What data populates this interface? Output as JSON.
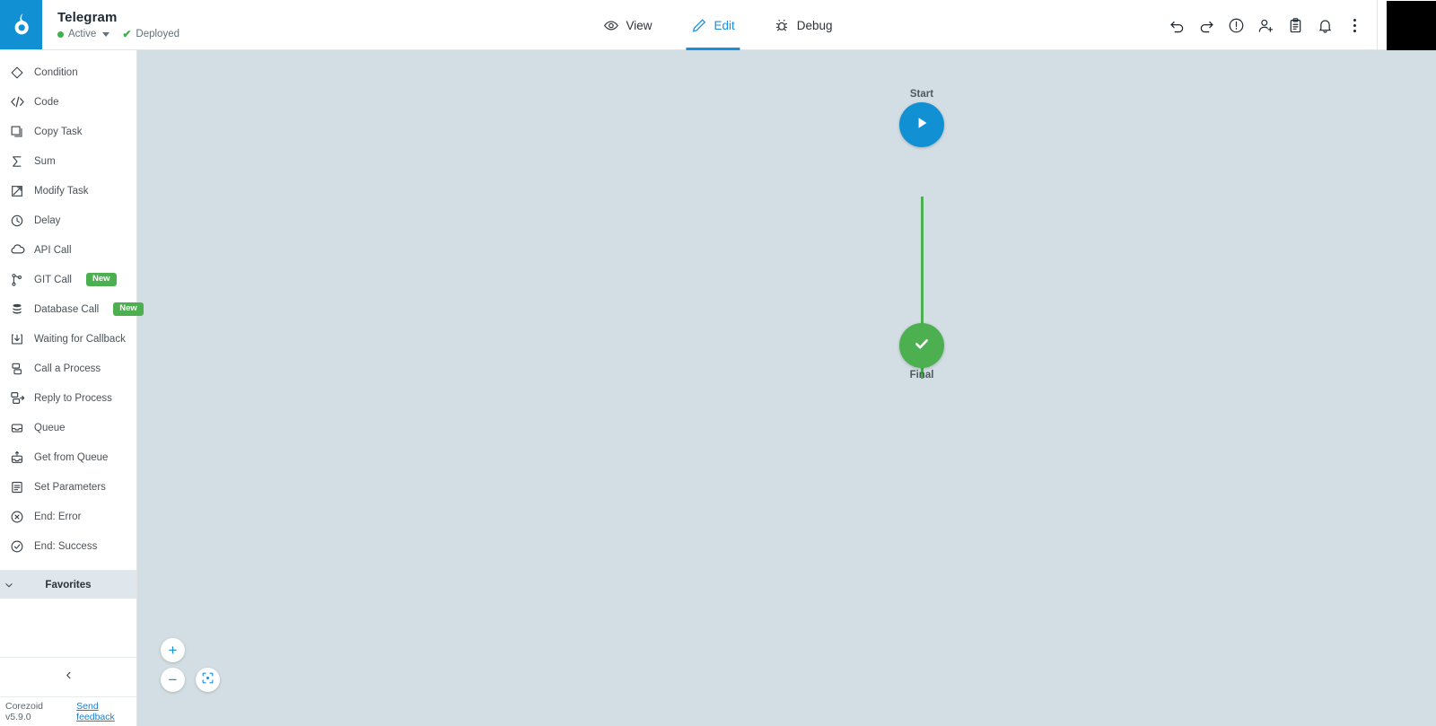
{
  "header": {
    "logo_icon": "corezoid-logo-icon",
    "title": "Telegram",
    "status_label": "Active",
    "deploy_label": "Deployed",
    "deploy_check": "✔",
    "tabs": [
      {
        "label": "View",
        "icon": "eye-icon",
        "active": false
      },
      {
        "label": "Edit",
        "icon": "pencil-icon",
        "active": true
      },
      {
        "label": "Debug",
        "icon": "bug-icon",
        "active": false
      }
    ],
    "actions": [
      {
        "name": "undo-icon"
      },
      {
        "name": "redo-icon"
      },
      {
        "name": "alert-circle-icon"
      },
      {
        "name": "add-user-icon"
      },
      {
        "name": "clipboard-icon"
      },
      {
        "name": "bell-icon"
      },
      {
        "name": "more-vertical-icon"
      }
    ],
    "avatar": "user-avatar"
  },
  "sidebar": {
    "items": [
      {
        "label": "Condition",
        "icon": "diamond-icon",
        "badge": ""
      },
      {
        "label": "Code",
        "icon": "code-icon",
        "badge": ""
      },
      {
        "label": "Copy Task",
        "icon": "copy-task-icon",
        "badge": ""
      },
      {
        "label": "Sum",
        "icon": "sigma-icon",
        "badge": ""
      },
      {
        "label": "Modify Task",
        "icon": "modify-task-icon",
        "badge": ""
      },
      {
        "label": "Delay",
        "icon": "clock-icon",
        "badge": ""
      },
      {
        "label": "API Call",
        "icon": "cloud-icon",
        "badge": ""
      },
      {
        "label": "GIT Call",
        "icon": "git-branch-icon",
        "badge": "New"
      },
      {
        "label": "Database Call",
        "icon": "database-icon",
        "badge": "New"
      },
      {
        "label": "Waiting for Callback",
        "icon": "download-box-icon",
        "badge": ""
      },
      {
        "label": "Call a Process",
        "icon": "call-process-icon",
        "badge": ""
      },
      {
        "label": "Reply to Process",
        "icon": "reply-process-icon",
        "badge": ""
      },
      {
        "label": "Queue",
        "icon": "queue-icon",
        "badge": ""
      },
      {
        "label": "Get from Queue",
        "icon": "get-from-queue-icon",
        "badge": ""
      },
      {
        "label": "Set Parameters",
        "icon": "set-parameters-icon",
        "badge": ""
      },
      {
        "label": "End: Error",
        "icon": "x-circle-icon",
        "badge": ""
      },
      {
        "label": "End: Success",
        "icon": "check-circle-icon",
        "badge": ""
      }
    ],
    "favorites_label": "Favorites",
    "collapse_icon": "chevron-left-icon",
    "version": "Corezoid v5.9.0",
    "feedback_link": "Send feedback"
  },
  "canvas": {
    "nodes": [
      {
        "id": "start",
        "label": "Start",
        "icon": "play-icon",
        "color": "#1290d4"
      },
      {
        "id": "final",
        "label": "Final",
        "icon": "check-icon",
        "color": "#4caf50"
      }
    ],
    "connector_color": "#4caf50",
    "background": "#d2dee3",
    "zoom_controls": [
      {
        "name": "zoom-in-button",
        "glyph": "+"
      },
      {
        "name": "zoom-out-button",
        "glyph": "−"
      },
      {
        "name": "fit-screen-button",
        "glyph": ""
      }
    ]
  }
}
